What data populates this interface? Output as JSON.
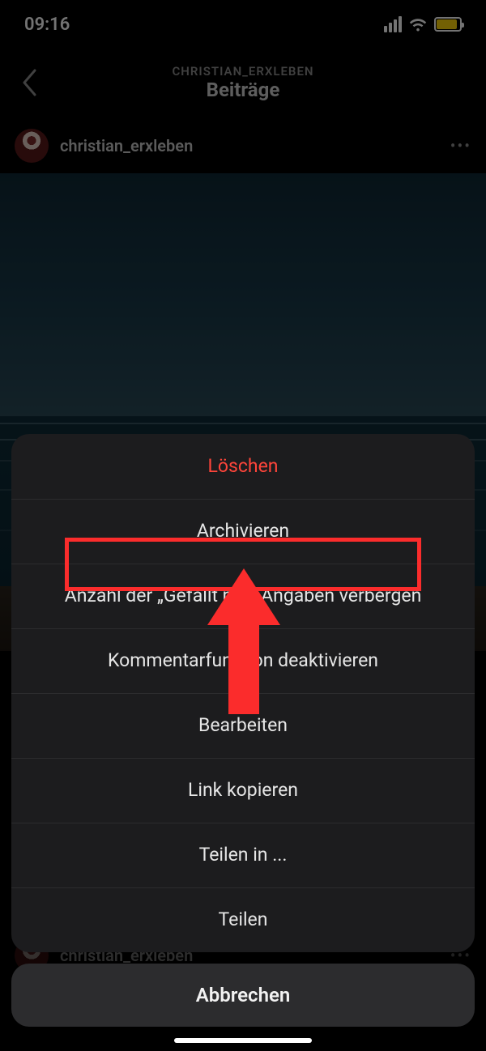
{
  "status": {
    "time": "09:16"
  },
  "header": {
    "subtitle": "CHRISTIAN_ERXLEBEN",
    "title": "Beiträge"
  },
  "post": {
    "username": "christian_erxleben"
  },
  "post2": {
    "username": "christian_erxleben"
  },
  "sheet": {
    "items": {
      "delete": "Löschen",
      "archive": "Archivieren",
      "hide_likes": "Anzahl der „Gefällt mir\"-Angaben verbergen",
      "disable_comments": "Kommentarfunktion deaktivieren",
      "edit": "Bearbeiten",
      "copy_link": "Link kopieren",
      "share_in": "Teilen in ...",
      "share": "Teilen"
    },
    "cancel": "Abbrechen"
  }
}
